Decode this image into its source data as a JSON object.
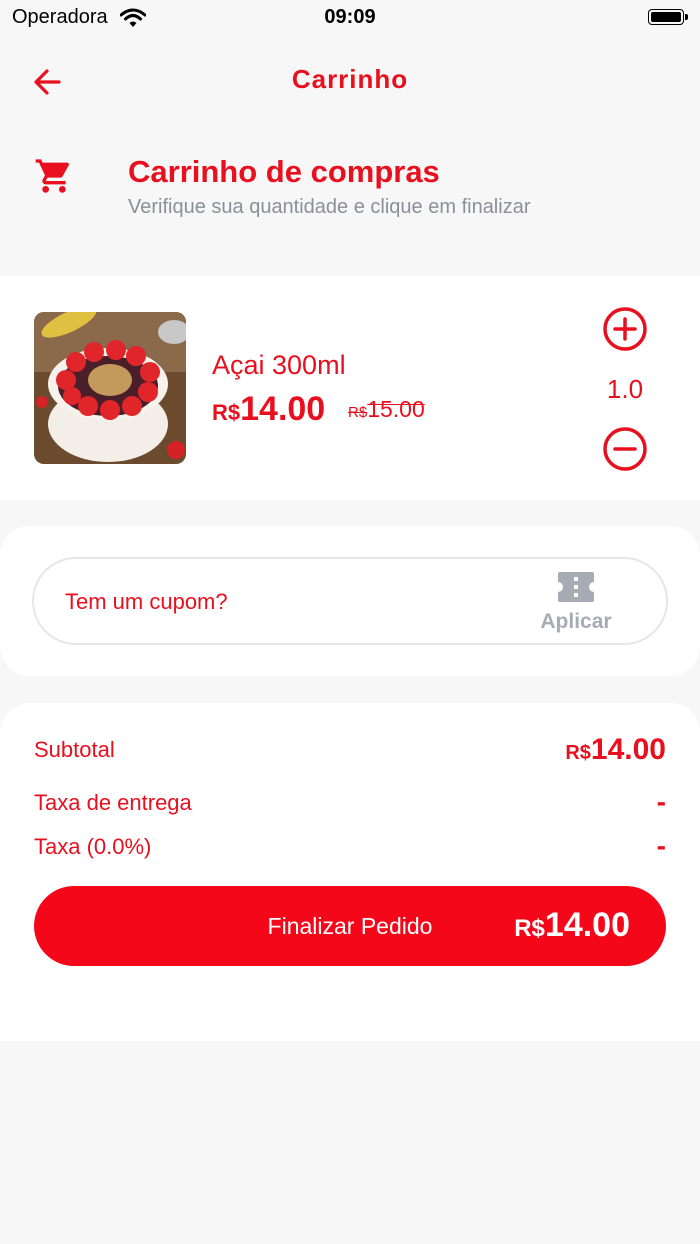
{
  "status_bar": {
    "carrier": "Operadora",
    "time": "09:09"
  },
  "header": {
    "title": "Carrinho"
  },
  "section": {
    "title": "Carrinho de compras",
    "subtitle": "Verifique sua quantidade e clique em finalizar"
  },
  "cart_item": {
    "name": "Açai 300ml",
    "currency": "R$",
    "price": "14.00",
    "old_price": "15.00",
    "quantity": "1.0"
  },
  "coupon": {
    "prompt": "Tem um cupom?",
    "apply_label": "Aplicar"
  },
  "summary": {
    "subtotal_label": "Subtotal",
    "subtotal_value": "14.00",
    "delivery_label": "Taxa de entrega",
    "delivery_value": "-",
    "tax_label": "Taxa (0.0%)",
    "tax_value": "-"
  },
  "checkout": {
    "label": "Finalizar Pedido",
    "total": "14.00"
  },
  "colors": {
    "accent": "#e8101e",
    "button": "#f5071a",
    "muted": "#8a8f99"
  }
}
